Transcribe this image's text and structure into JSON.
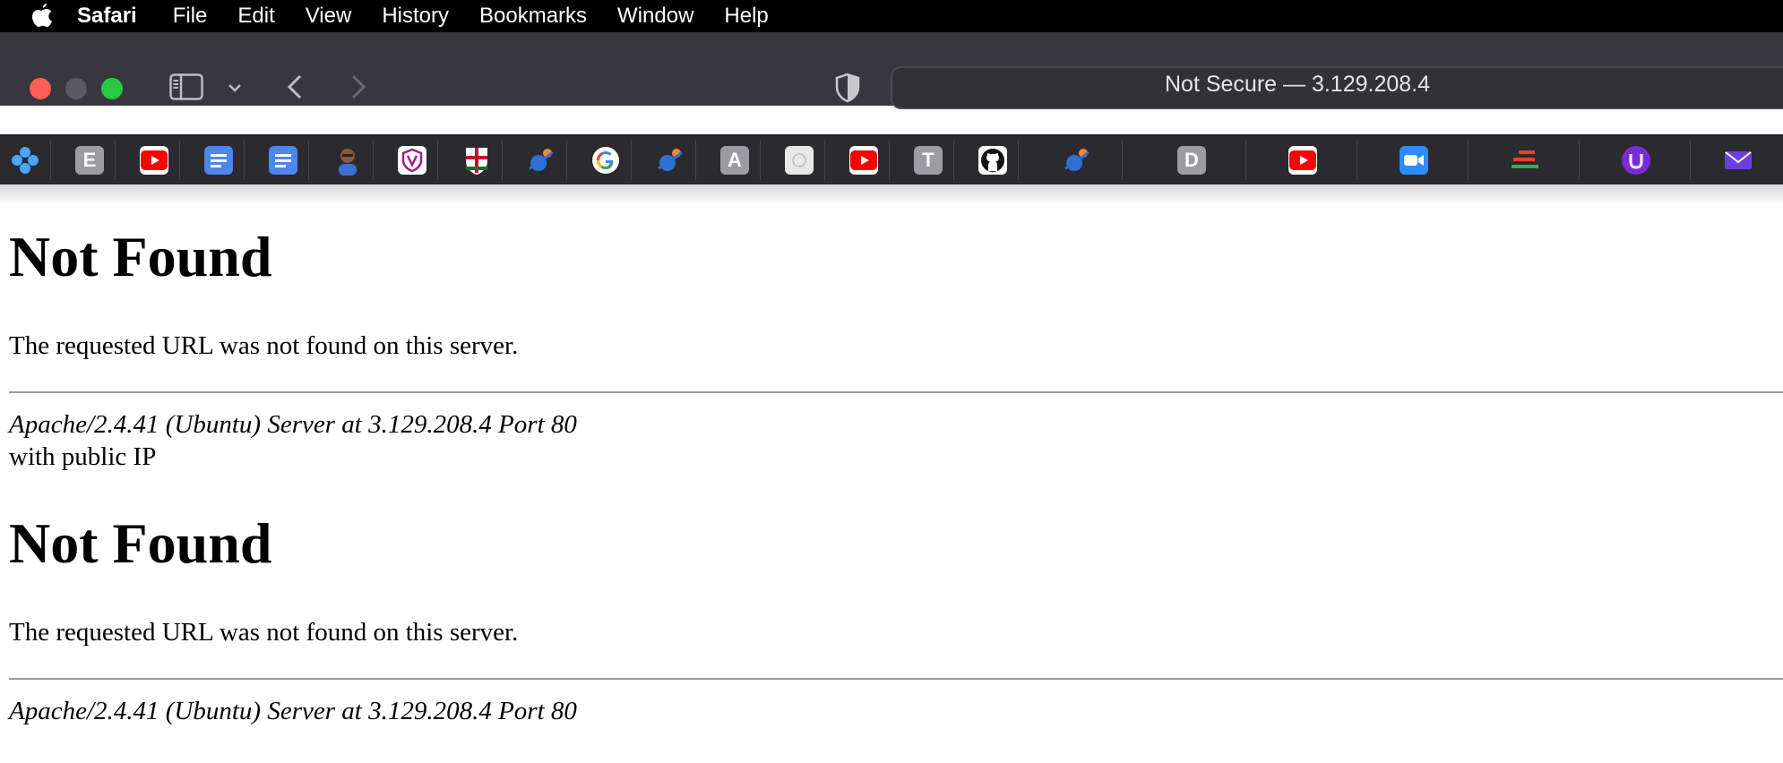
{
  "menubar": {
    "app_name": "Safari",
    "items": [
      "File",
      "Edit",
      "View",
      "History",
      "Bookmarks",
      "Window",
      "Help"
    ]
  },
  "toolbar": {
    "url_text": "Not Secure — 3.129.208.4"
  },
  "favorites": {
    "tiles": [
      {
        "kind": "dots-icon",
        "label": ""
      },
      {
        "kind": "letter",
        "label": "E"
      },
      {
        "kind": "youtube-icon",
        "label": ""
      },
      {
        "kind": "docs-icon",
        "label": ""
      },
      {
        "kind": "docs-icon",
        "label": ""
      },
      {
        "kind": "avatar-icon",
        "label": ""
      },
      {
        "kind": "shield-v-icon",
        "label": ""
      },
      {
        "kind": "crest-icon",
        "label": ""
      },
      {
        "kind": "planet-icon",
        "label": ""
      },
      {
        "kind": "google-icon",
        "label": ""
      },
      {
        "kind": "planet-icon",
        "label": ""
      },
      {
        "kind": "letter",
        "label": "A"
      },
      {
        "kind": "white-icon",
        "label": ""
      },
      {
        "kind": "youtube-icon",
        "label": ""
      },
      {
        "kind": "letter",
        "label": "T"
      },
      {
        "kind": "github-icon",
        "label": ""
      },
      {
        "kind": "planet-icon",
        "label": ""
      },
      {
        "kind": "letter",
        "label": "D"
      },
      {
        "kind": "youtube-icon",
        "label": ""
      },
      {
        "kind": "zoom-icon",
        "label": ""
      },
      {
        "kind": "stack-icon",
        "label": ""
      },
      {
        "kind": "u-icon",
        "label": ""
      },
      {
        "kind": "mail-icon",
        "label": ""
      }
    ]
  },
  "page": {
    "block1": {
      "heading": "Not Found",
      "message": "The requested URL was not found on this server.",
      "address": "Apache/2.4.41 (Ubuntu) Server at 3.129.208.4 Port 80"
    },
    "between_text": "with public IP",
    "block2": {
      "heading": "Not Found",
      "message": "The requested URL was not found on this server.",
      "address": "Apache/2.4.41 (Ubuntu) Server at 3.129.208.4 Port 80"
    }
  }
}
